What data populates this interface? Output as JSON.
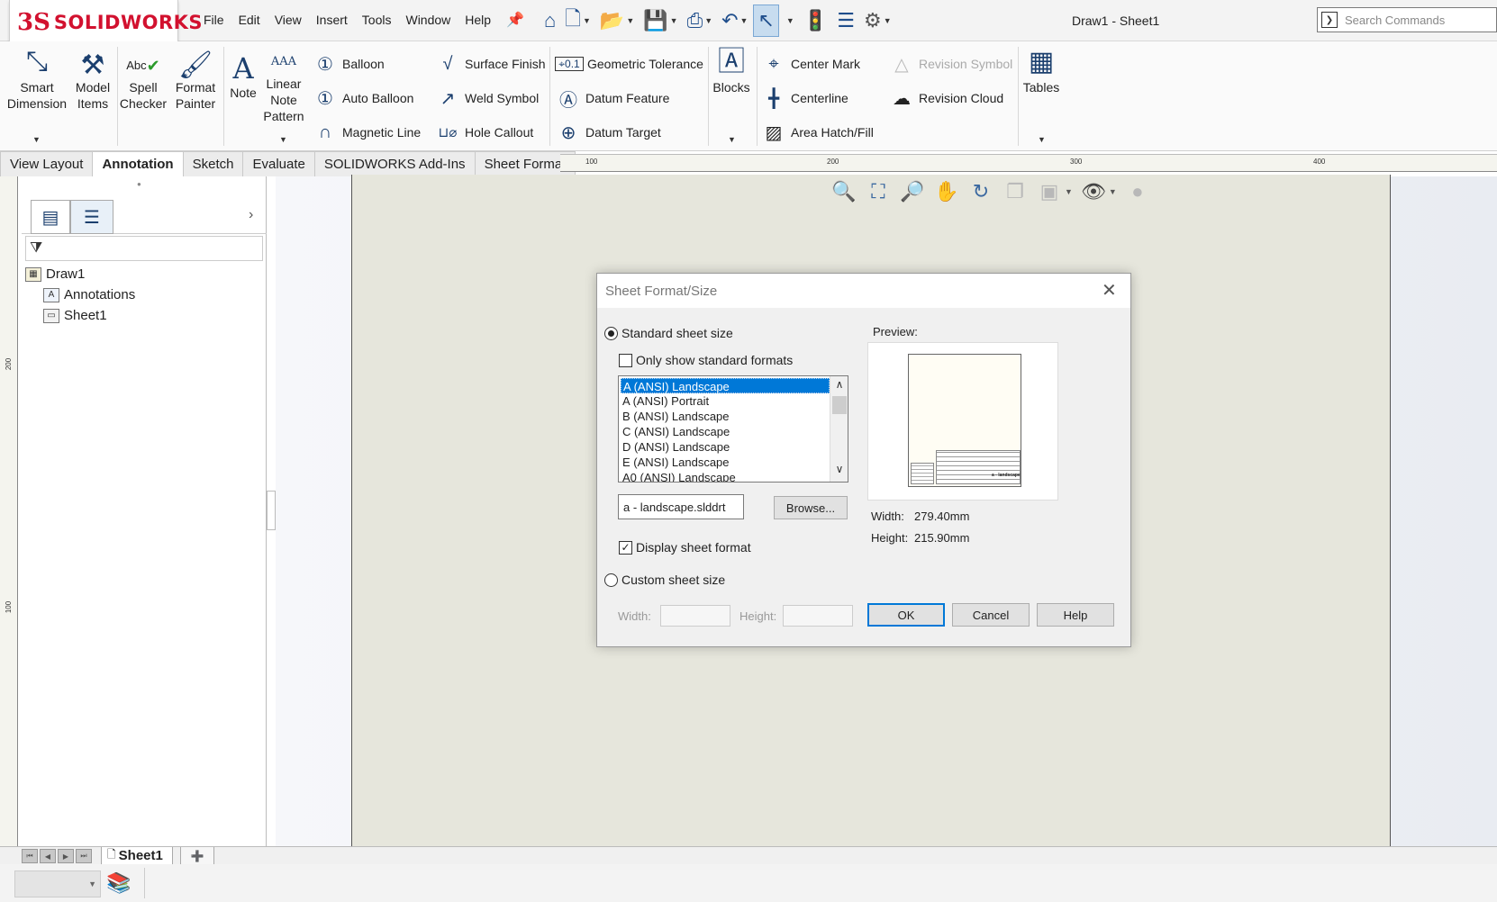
{
  "app": {
    "brand": "SOLIDWORKS",
    "brand_mark": "3S",
    "doc_title": "Draw1 - Sheet1",
    "search_placeholder": "Search Commands"
  },
  "menu": [
    "File",
    "Edit",
    "View",
    "Insert",
    "Tools",
    "Window",
    "Help"
  ],
  "ribbon": {
    "smart_dimension": "Smart Dimension",
    "model_items": "Model Items",
    "spell_checker": "Spell Checker",
    "spell_checker_icon_text": "Abc",
    "format_painter": "Format Painter",
    "note": "Note",
    "note_icon_text": "A",
    "linear_note_pattern": "Linear Note Pattern",
    "linear_note_icon_text": "AAA",
    "balloon": "Balloon",
    "auto_balloon": "Auto Balloon",
    "magnetic_line": "Magnetic Line",
    "surface_finish": "Surface Finish",
    "weld_symbol": "Weld Symbol",
    "hole_callout": "Hole Callout",
    "geometric_tolerance": "Geometric Tolerance",
    "datum_feature": "Datum Feature",
    "datum_target": "Datum Target",
    "blocks": "Blocks",
    "center_mark": "Center Mark",
    "centerline": "Centerline",
    "area_hatch_fill": "Area Hatch/Fill",
    "revision_symbol": "Revision Symbol",
    "revision_cloud": "Revision Cloud",
    "tables": "Tables"
  },
  "tabs": [
    {
      "label": "View Layout",
      "active": false
    },
    {
      "label": "Annotation",
      "active": true
    },
    {
      "label": "Sketch",
      "active": false
    },
    {
      "label": "Evaluate",
      "active": false
    },
    {
      "label": "SOLIDWORKS Add-Ins",
      "active": false
    },
    {
      "label": "Sheet Format",
      "active": false
    }
  ],
  "rulers": {
    "horizontal": [
      "100",
      "200",
      "300",
      "400"
    ],
    "vertical": [
      "200",
      "100"
    ]
  },
  "feature_tree": {
    "root": "Draw1",
    "children": [
      "Annotations",
      "Sheet1"
    ]
  },
  "sheet_tabs": {
    "active": "Sheet1"
  },
  "dialog": {
    "title": "Sheet Format/Size",
    "standard_size_label": "Standard sheet size",
    "standard_size_selected": true,
    "only_standard_label": "Only show standard formats",
    "only_standard_checked": false,
    "formats": [
      "A (ANSI) Landscape",
      "A (ANSI) Portrait",
      "B (ANSI) Landscape",
      "C (ANSI) Landscape",
      "D (ANSI) Landscape",
      "E (ANSI) Landscape",
      "A0 (ANSI) Landscape"
    ],
    "selected_format": "A (ANSI) Landscape",
    "format_file": "a - landscape.slddrt",
    "browse_label": "Browse...",
    "display_format_label": "Display sheet format",
    "display_format_checked": true,
    "custom_size_label": "Custom sheet size",
    "custom_size_selected": false,
    "custom_width_label": "Width:",
    "custom_height_label": "Height:",
    "preview_label": "Preview:",
    "preview_caption": "a - landscape",
    "width_label": "Width:",
    "width_value": "279.40mm",
    "height_label": "Height:",
    "height_value": "215.90mm",
    "ok_label": "OK",
    "cancel_label": "Cancel",
    "help_label": "Help"
  },
  "colors": {
    "brand": "#d2112f",
    "selection": "#0078d7",
    "sheet_bg": "#e6e6dc",
    "accent_icon": "#1b3f6e"
  }
}
